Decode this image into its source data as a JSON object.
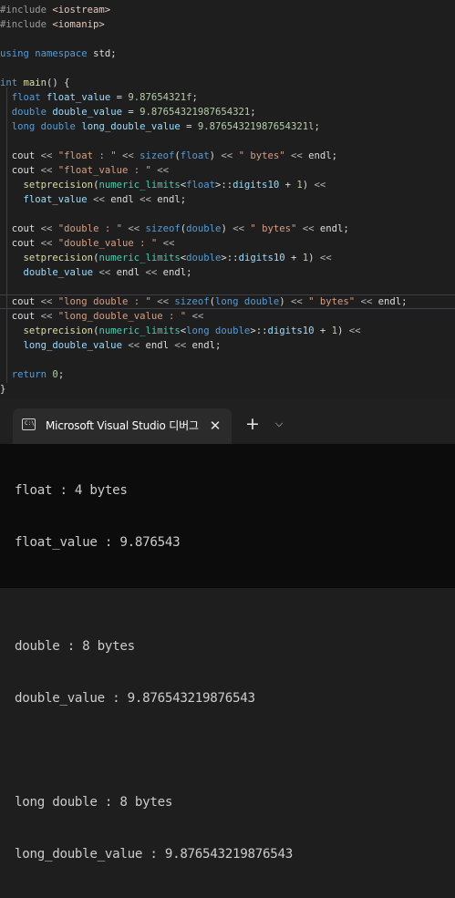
{
  "editor": {
    "lines": [
      {
        "tokens": [
          [
            "pp",
            "#include "
          ],
          [
            "inc",
            "<iostream>"
          ]
        ]
      },
      {
        "tokens": [
          [
            "pp",
            "#include "
          ],
          [
            "inc",
            "<iomanip>"
          ]
        ]
      },
      {
        "tokens": []
      },
      {
        "tokens": [
          [
            "kw",
            "using namespace "
          ],
          [
            "ns",
            "std;"
          ]
        ]
      },
      {
        "tokens": []
      },
      {
        "tokens": [
          [
            "kw",
            "int "
          ],
          [
            "fn",
            "main"
          ],
          [
            "ns",
            "() {"
          ]
        ]
      },
      {
        "tokens": [
          [
            "ns",
            "  "
          ],
          [
            "kw",
            "float "
          ],
          [
            "id",
            "float_value"
          ],
          [
            "ns",
            " = "
          ],
          [
            "num",
            "9.87654321f"
          ],
          [
            "ns",
            ";"
          ]
        ]
      },
      {
        "tokens": [
          [
            "ns",
            "  "
          ],
          [
            "kw",
            "double "
          ],
          [
            "id",
            "double_value"
          ],
          [
            "ns",
            " = "
          ],
          [
            "num",
            "9.87654321987654321"
          ],
          [
            "ns",
            ";"
          ]
        ]
      },
      {
        "tokens": [
          [
            "ns",
            "  "
          ],
          [
            "kw",
            "long double "
          ],
          [
            "id",
            "long_double_value"
          ],
          [
            "ns",
            " = "
          ],
          [
            "num",
            "9.87654321987654321l"
          ],
          [
            "ns",
            ";"
          ]
        ]
      },
      {
        "tokens": []
      },
      {
        "tokens": [
          [
            "ns",
            "  cout "
          ],
          [
            "op",
            "<< "
          ],
          [
            "str",
            "\"float : \""
          ],
          [
            "op",
            " << "
          ],
          [
            "kw",
            "sizeof"
          ],
          [
            "ns",
            "("
          ],
          [
            "kw",
            "float"
          ],
          [
            "ns",
            ") "
          ],
          [
            "op",
            "<< "
          ],
          [
            "str",
            "\" bytes\""
          ],
          [
            "op",
            " << "
          ],
          [
            "ns",
            "endl;"
          ]
        ]
      },
      {
        "tokens": [
          [
            "ns",
            "  cout "
          ],
          [
            "op",
            "<< "
          ],
          [
            "str",
            "\"float_value : \""
          ],
          [
            "op",
            " <<"
          ]
        ]
      },
      {
        "tokens": [
          [
            "ns",
            "    "
          ],
          [
            "fn",
            "setprecision"
          ],
          [
            "ns",
            "("
          ],
          [
            "tp",
            "numeric_limits"
          ],
          [
            "ns",
            "<"
          ],
          [
            "kw",
            "float"
          ],
          [
            "ns",
            ">::"
          ],
          [
            "id",
            "digits10"
          ],
          [
            "ns",
            " + "
          ],
          [
            "num",
            "1"
          ],
          [
            "ns",
            ") "
          ],
          [
            "op",
            "<<"
          ]
        ]
      },
      {
        "tokens": [
          [
            "ns",
            "    "
          ],
          [
            "id",
            "float_value"
          ],
          [
            "op",
            " << "
          ],
          [
            "ns",
            "endl "
          ],
          [
            "op",
            "<< "
          ],
          [
            "ns",
            "endl;"
          ]
        ]
      },
      {
        "tokens": []
      },
      {
        "tokens": [
          [
            "ns",
            "  cout "
          ],
          [
            "op",
            "<< "
          ],
          [
            "str",
            "\"double : \""
          ],
          [
            "op",
            " << "
          ],
          [
            "kw",
            "sizeof"
          ],
          [
            "ns",
            "("
          ],
          [
            "kw",
            "double"
          ],
          [
            "ns",
            ") "
          ],
          [
            "op",
            "<< "
          ],
          [
            "str",
            "\" bytes\""
          ],
          [
            "op",
            " << "
          ],
          [
            "ns",
            "endl;"
          ]
        ]
      },
      {
        "tokens": [
          [
            "ns",
            "  cout "
          ],
          [
            "op",
            "<< "
          ],
          [
            "str",
            "\"double_value : \""
          ],
          [
            "op",
            " <<"
          ]
        ]
      },
      {
        "tokens": [
          [
            "ns",
            "    "
          ],
          [
            "fn",
            "setprecision"
          ],
          [
            "ns",
            "("
          ],
          [
            "tp",
            "numeric_limits"
          ],
          [
            "ns",
            "<"
          ],
          [
            "kw",
            "double"
          ],
          [
            "ns",
            ">::"
          ],
          [
            "id",
            "digits10"
          ],
          [
            "ns",
            " + "
          ],
          [
            "num",
            "1"
          ],
          [
            "ns",
            ") "
          ],
          [
            "op",
            "<<"
          ]
        ]
      },
      {
        "tokens": [
          [
            "ns",
            "    "
          ],
          [
            "id",
            "double_value"
          ],
          [
            "op",
            " << "
          ],
          [
            "ns",
            "endl "
          ],
          [
            "op",
            "<< "
          ],
          [
            "ns",
            "endl;"
          ]
        ]
      },
      {
        "tokens": []
      },
      {
        "tokens": [
          [
            "ns",
            "  cout "
          ],
          [
            "op",
            "<< "
          ],
          [
            "str",
            "\"long double : \""
          ],
          [
            "op",
            " << "
          ],
          [
            "kw",
            "sizeof"
          ],
          [
            "ns",
            "("
          ],
          [
            "kw",
            "long double"
          ],
          [
            "ns",
            ") "
          ],
          [
            "op",
            "<< "
          ],
          [
            "str",
            "\" bytes\""
          ],
          [
            "op",
            " << "
          ],
          [
            "ns",
            "endl;"
          ]
        ],
        "current": true
      },
      {
        "tokens": [
          [
            "ns",
            "  cout "
          ],
          [
            "op",
            "<< "
          ],
          [
            "str",
            "\"long_double_value : \""
          ],
          [
            "op",
            " <<"
          ]
        ]
      },
      {
        "tokens": [
          [
            "ns",
            "    "
          ],
          [
            "fn",
            "setprecision"
          ],
          [
            "ns",
            "("
          ],
          [
            "tp",
            "numeric_limits"
          ],
          [
            "ns",
            "<"
          ],
          [
            "kw",
            "long double"
          ],
          [
            "ns",
            ">::"
          ],
          [
            "id",
            "digits10"
          ],
          [
            "ns",
            " + "
          ],
          [
            "num",
            "1"
          ],
          [
            "ns",
            ") "
          ],
          [
            "op",
            "<<"
          ]
        ]
      },
      {
        "tokens": [
          [
            "ns",
            "    "
          ],
          [
            "id",
            "long_double_value"
          ],
          [
            "op",
            " << "
          ],
          [
            "ns",
            "endl "
          ],
          [
            "op",
            "<< "
          ],
          [
            "ns",
            "endl;"
          ]
        ]
      },
      {
        "tokens": []
      },
      {
        "tokens": [
          [
            "ns",
            "  "
          ],
          [
            "kw",
            "return "
          ],
          [
            "num",
            "0"
          ],
          [
            "ns",
            ";"
          ]
        ]
      },
      {
        "tokens": [
          [
            "ns",
            "}"
          ]
        ]
      }
    ]
  },
  "terminal": {
    "tab": {
      "icon_label": "C:\\",
      "icon": "console-icon",
      "title": "Microsoft Visual Studio 디버그",
      "close_label": "✕"
    },
    "new_tab_label": "+",
    "dropdown_label": "⌵",
    "output": [
      "float : 4 bytes",
      "float_value : 9.876543",
      "",
      "double : 8 bytes",
      "double_value : 9.876543219876543",
      "",
      "long double : 8 bytes",
      "long_double_value : 9.876543219876543"
    ]
  }
}
